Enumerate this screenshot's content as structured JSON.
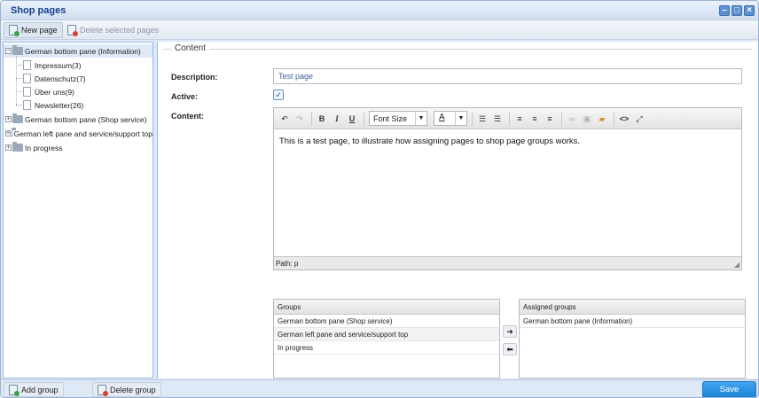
{
  "window": {
    "title": "Shop pages"
  },
  "toolbar": {
    "new_page": "New page",
    "delete_selected": "Delete selected pages"
  },
  "tree": {
    "groups": [
      {
        "label": "German bottom pane (Information)",
        "expanded": true,
        "selected": true,
        "children": [
          "Impressum(3)",
          "Datenschutz(7)",
          "Über uns(9)",
          "Newsletter(26)"
        ]
      },
      {
        "label": "German bottom pane (Shop service)",
        "expanded": false
      },
      {
        "label": "German left pane and service/support top",
        "expanded": false
      },
      {
        "label": "In progress",
        "expanded": false
      }
    ]
  },
  "form": {
    "section_title": "Content",
    "description_label": "Description:",
    "description_value": "Test page",
    "active_label": "Active:",
    "active_checked": true,
    "content_label": "Content:"
  },
  "editor": {
    "font_size_label": "Font Size",
    "body": "This is a test page, to illustrate how assigning pages to shop page groups works.",
    "path": "Path: p"
  },
  "groups_grid": {
    "header": "Groups",
    "rows": [
      "German bottom pane (Shop service)",
      "German left pane and service/support top",
      "In progress"
    ]
  },
  "assigned_grid": {
    "header": "Assigned groups",
    "rows": [
      "German bottom pane (Information)"
    ]
  },
  "bottom": {
    "add_group": "Add group",
    "delete_group": "Delete group",
    "save": "Save"
  },
  "colors": {
    "accent": "#1f83d6",
    "panel": "#dfe8f6",
    "title": "#15428b"
  }
}
